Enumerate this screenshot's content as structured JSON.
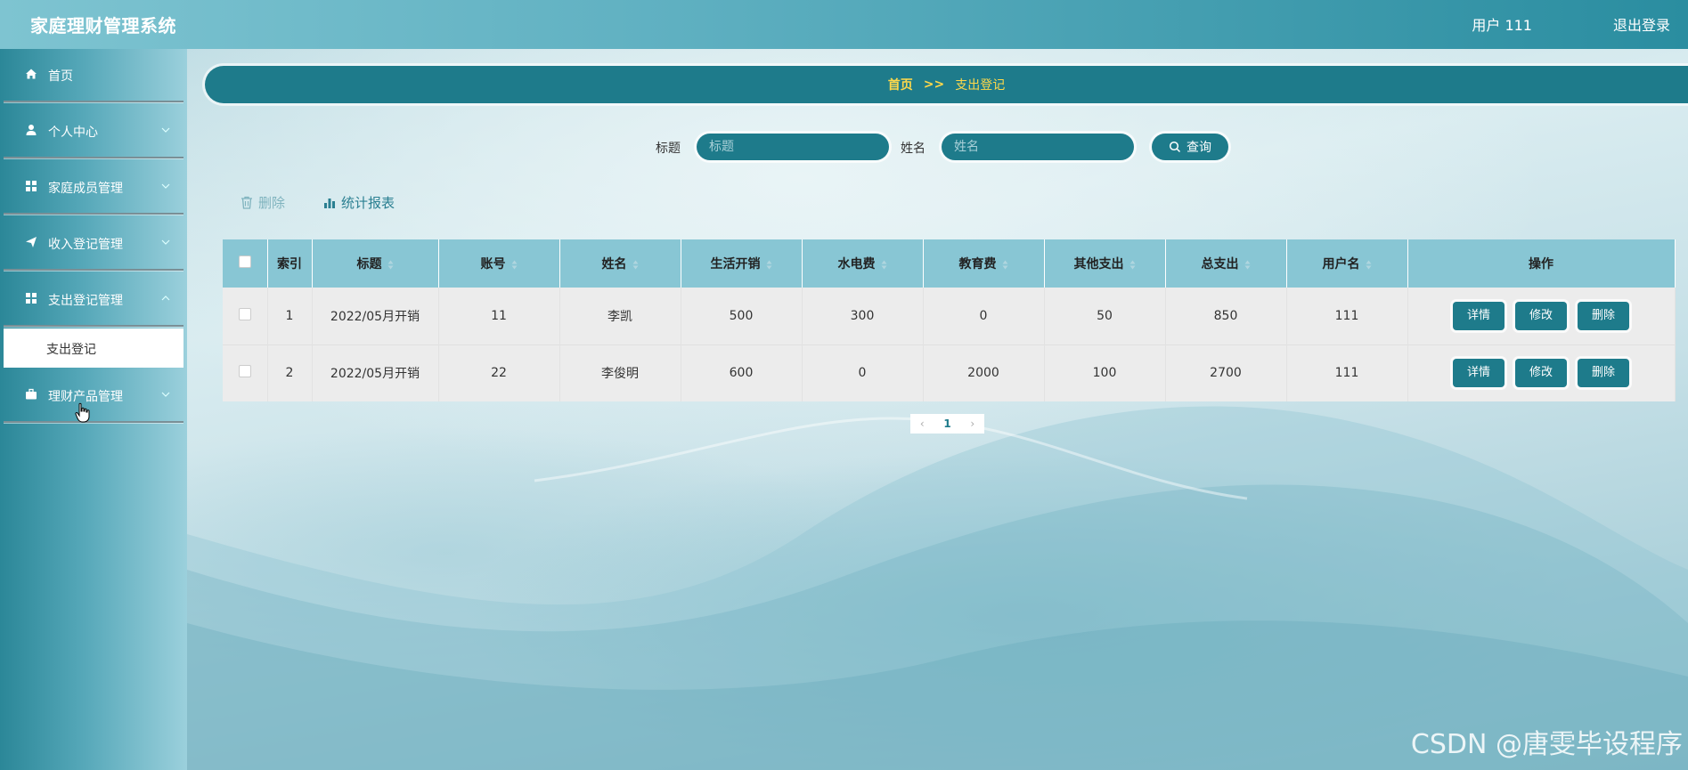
{
  "header": {
    "app_title": "家庭理财管理系统",
    "user_info": "用户 111",
    "logout": "退出登录"
  },
  "sidebar": {
    "items": [
      {
        "label": "首页",
        "icon": "home-icon"
      },
      {
        "label": "个人中心",
        "icon": "user-icon"
      },
      {
        "label": "家庭成员管理",
        "icon": "grid-icon"
      },
      {
        "label": "收入登记管理",
        "icon": "send-icon"
      },
      {
        "label": "支出登记管理",
        "icon": "grid-icon"
      },
      {
        "label": "理财产品管理",
        "icon": "briefcase-icon"
      }
    ],
    "active_sub": "支出登记"
  },
  "breadcrumb": {
    "home": "首页",
    "sep": ">>",
    "current": "支出登记"
  },
  "search": {
    "title_label": "标题",
    "title_placeholder": "标题",
    "name_label": "姓名",
    "name_placeholder": "姓名",
    "query_label": "查询"
  },
  "actions": {
    "delete": "删除",
    "report": "统计报表"
  },
  "table": {
    "headers": [
      "索引",
      "标题",
      "账号",
      "姓名",
      "生活开销",
      "水电费",
      "教育费",
      "其他支出",
      "总支出",
      "用户名",
      "操作"
    ],
    "rows": [
      [
        "1",
        "2022/05月开销",
        "11",
        "李凯",
        "500",
        "300",
        "0",
        "50",
        "850",
        "111"
      ],
      [
        "2",
        "2022/05月开销",
        "22",
        "李俊明",
        "600",
        "0",
        "2000",
        "100",
        "2700",
        "111"
      ]
    ],
    "row_actions": {
      "detail": "详情",
      "edit": "修改",
      "delete": "删除"
    }
  },
  "pagination": {
    "current_page": "1"
  },
  "watermark": "CSDN @唐雯毕设程序",
  "colors": {
    "primary": "#1e7b8b",
    "breadcrumb_text": "#ffd94a",
    "table_header": "#88c6d4"
  }
}
